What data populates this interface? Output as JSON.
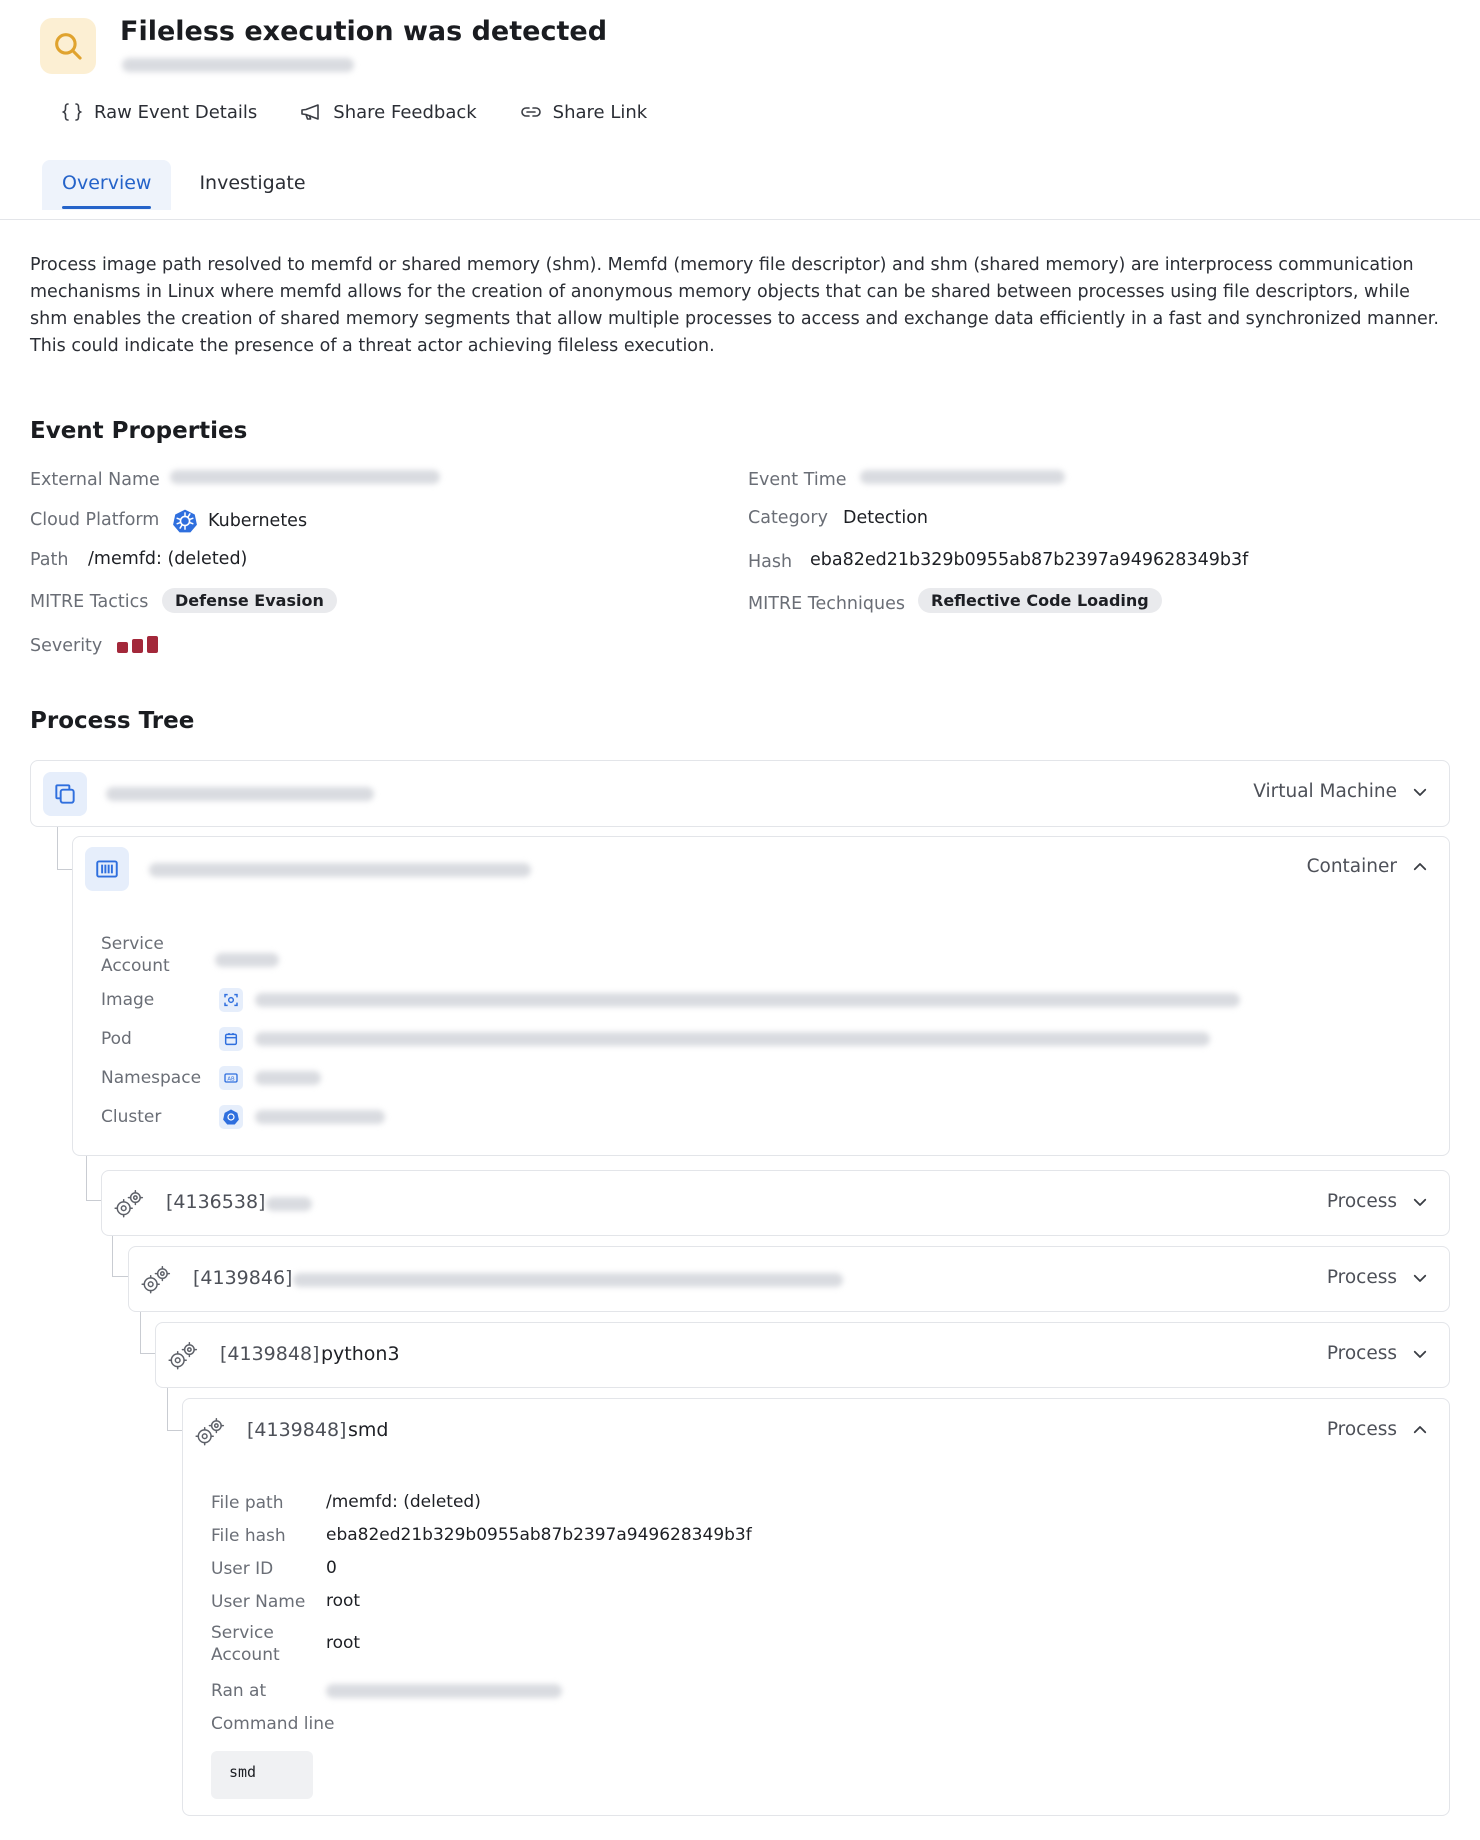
{
  "header": {
    "title": "Fileless execution was detected",
    "icon": "search-icon",
    "accent": "#e0a32e"
  },
  "actions": {
    "raw_event": "Raw Event Details",
    "share_feedback": "Share Feedback",
    "share_link": "Share Link"
  },
  "tabs": [
    {
      "label": "Overview",
      "active": true
    },
    {
      "label": "Investigate",
      "active": false
    }
  ],
  "description": "Process image path resolved to memfd or shared memory (shm). Memfd (memory file descriptor) and shm (shared memory) are interprocess communication mechanisms in Linux where memfd allows for the creation of anonymous memory objects that can be shared between processes using file descriptors, while shm enables the creation of shared memory segments that allow multiple processes to access and exchange data efficiently in a fast and synchronized manner. This could indicate the presence of a threat actor achieving fileless execution.",
  "event_properties": {
    "title": "Event Properties",
    "external_name_label": "External Name",
    "cloud_platform_label": "Cloud Platform",
    "cloud_platform_value": "Kubernetes",
    "path_label": "Path",
    "path_value": "/memfd: (deleted)",
    "mitre_tactics_label": "MITRE Tactics",
    "mitre_tactics_value": "Defense Evasion",
    "severity_label": "Severity",
    "severity_level": 3,
    "severity_color": "#a3283a",
    "event_time_label": "Event Time",
    "category_label": "Category",
    "category_value": "Detection",
    "hash_label": "Hash",
    "hash_value": "eba82ed21b329b0955ab87b2397a949628349b3f",
    "mitre_techniques_label": "MITRE Techniques",
    "mitre_techniques_value": "Reflective Code Loading"
  },
  "process_tree": {
    "title": "Process Tree",
    "vm": {
      "type": "Virtual Machine"
    },
    "container": {
      "type": "Container",
      "service_account_label": "Service\nAccount",
      "image_label": "Image",
      "pod_label": "Pod",
      "namespace_label": "Namespace",
      "cluster_label": "Cluster"
    },
    "processes": [
      {
        "pid": "[4136538]",
        "name": "",
        "type": "Process"
      },
      {
        "pid": "[4139846]",
        "name": "",
        "type": "Process"
      },
      {
        "pid": "[4139848]",
        "name": "python3",
        "type": "Process"
      },
      {
        "pid": "[4139848]",
        "name": "smd",
        "type": "Process"
      }
    ],
    "details": {
      "file_path_label": "File path",
      "file_path_value": "/memfd: (deleted)",
      "file_hash_label": "File hash",
      "file_hash_value": "eba82ed21b329b0955ab87b2397a949628349b3f",
      "user_id_label": "User ID",
      "user_id_value": "0",
      "user_name_label": "User Name",
      "user_name_value": "root",
      "service_account_label": "Service\nAccount",
      "service_account_value": "root",
      "ran_at_label": "Ran at",
      "command_line_label": "Command line",
      "command_line_value": "smd"
    }
  }
}
